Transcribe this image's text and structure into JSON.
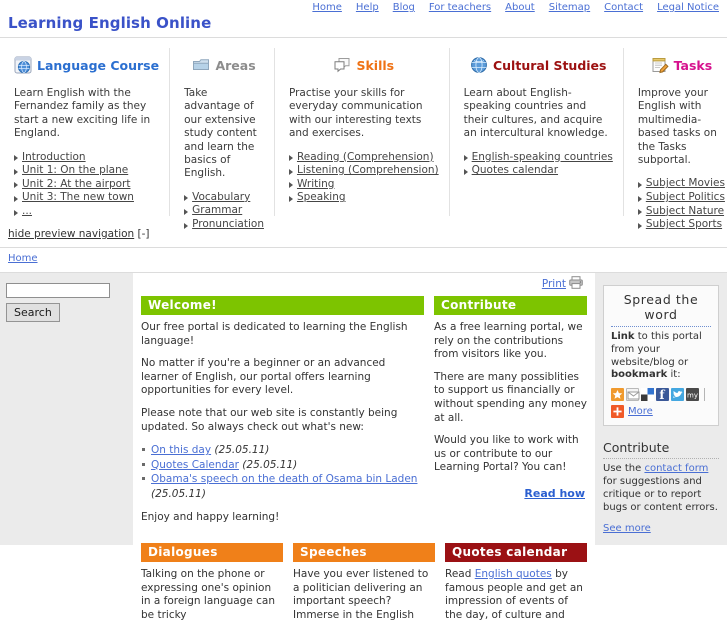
{
  "topnav": {
    "items": [
      {
        "label": "Home"
      },
      {
        "label": "Help"
      },
      {
        "label": "Blog"
      },
      {
        "label": "For teachers"
      },
      {
        "label": "About"
      },
      {
        "label": "Sitemap"
      },
      {
        "label": "Contact"
      },
      {
        "label": "Legal Notice"
      }
    ]
  },
  "site": {
    "title": "Learning English Online"
  },
  "preview": {
    "columns": [
      {
        "icon": "globe-window-icon",
        "title": "Language Course",
        "color": "#2b6fd0",
        "desc": "Learn English with the Fernandez family as they start a new exciting life in England.",
        "links": [
          "Introduction",
          "Unit 1: On the plane",
          "Unit 2: At the airport",
          "Unit 3: The new town",
          "..."
        ]
      },
      {
        "icon": "folder-icon",
        "title": "Areas",
        "color": "#8d8d8d",
        "desc": "Take advantage of our extensive study content and learn the basics of English.",
        "links": [
          "Vocabulary",
          "Grammar",
          "Pronunciation"
        ]
      },
      {
        "icon": "speech-bubbles-icon",
        "title": "Skills",
        "color": "#ef7215",
        "desc": "Practise your skills for everyday communication with our interesting texts and exercises.",
        "links": [
          "Reading (Comprehension)",
          "Listening (Comprehension)",
          "Writing",
          "Speaking"
        ]
      },
      {
        "icon": "globe-icon",
        "title": "Cultural Studies",
        "color": "#9c1111",
        "desc": "Learn about English-speaking countries and their cultures, and acquire an intercultural knowledge.",
        "links": [
          "English-speaking countries",
          "Quotes calendar"
        ]
      },
      {
        "icon": "notepad-pencil-icon",
        "title": "Tasks",
        "color": "#d6128e",
        "desc": "Improve your English with multimedia-based tasks on the Tasks subportal.",
        "links": [
          "Subject Movies",
          "Subject Politics",
          "Subject Nature",
          "Subject Sports"
        ]
      }
    ]
  },
  "hidebar": {
    "link": "hide preview navigation",
    "toggle": "[-]"
  },
  "breadcrumb": {
    "items": [
      "Home"
    ]
  },
  "search": {
    "value": "",
    "placeholder": "",
    "button": "Search"
  },
  "print": {
    "label": "Print",
    "icon": "printer-icon"
  },
  "main": {
    "welcome": {
      "heading": "Welcome!",
      "heading_color": "#7dc400",
      "p1": "Our free portal is dedicated to learning the English language!",
      "p2": "No matter if you're a beginner or an advanced learner of English, our portal offers learning opportunities for every level.",
      "p3": "Please note that our web site is constantly being updated. So always check out what's new:",
      "news": [
        {
          "link": "On this day",
          "date": "(25.05.11)"
        },
        {
          "link": "Quotes Calendar",
          "date": "(25.05.11)"
        },
        {
          "link": "Obama's speech on the death of Osama bin Laden",
          "date": "(25.05.11)"
        }
      ],
      "p4": "Enjoy and happy learning!"
    },
    "contribute": {
      "heading": "Contribute",
      "heading_color": "#7dc400",
      "p1": "As a free learning portal, we rely on the contributions from visitors like you.",
      "p2": "There are many possiblities to support us financially or without spending any money at all.",
      "p3": "Would you like to work with us or contribute to our Learning Portal? You can!",
      "cta": "Read how"
    },
    "dialogues": {
      "heading": "Dialogues",
      "heading_color": "#f08019",
      "text": "Talking on the phone or expressing one's opinion in a foreign language can be tricky"
    },
    "speeches": {
      "heading": "Speeches",
      "heading_color": "#f08019",
      "text": "Have you ever listened to a politician delivering an important speech? Immerse in the English"
    },
    "quotes": {
      "heading": "Quotes calendar",
      "heading_color": "#9b1114",
      "text_before": "Read ",
      "text_link": "English quotes",
      "text_after": " by famous people and get an impression of events of the day, of culture and"
    }
  },
  "sidebar": {
    "spread": {
      "title": "Spread the word",
      "text_bold1": "Link",
      "text_mid": " to this portal from your website/blog or ",
      "text_bold2": "bookmark",
      "text_end": " it:",
      "share_icons": [
        "favorites-star-icon",
        "email-icon",
        "delicious-icon",
        "facebook-icon",
        "twitter-icon",
        "myspace-icon"
      ],
      "more_label": "More",
      "more_icon": "addthis-plus-icon"
    },
    "contribute": {
      "title": "Contribute",
      "text_before": "Use the ",
      "text_link": "contact form",
      "text_after": " for suggestions and critique or to report bugs or content errors.",
      "see_more": "See more"
    }
  }
}
